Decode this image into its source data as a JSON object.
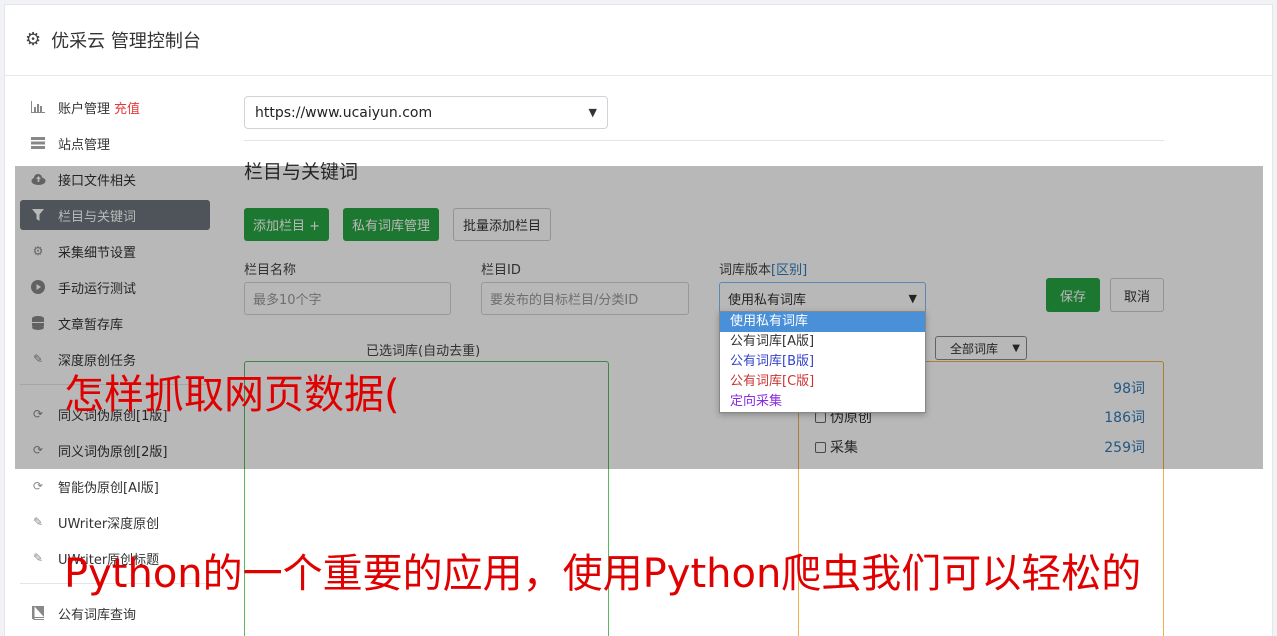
{
  "header": {
    "title": "优采云 管理控制台",
    "icon": "gear-icon"
  },
  "sidebar": {
    "items": [
      {
        "label": "账户管理",
        "extra": "充值",
        "icon": "bar-chart-icon"
      },
      {
        "label": "站点管理",
        "icon": "server-icon"
      },
      {
        "label": "接口文件相关",
        "icon": "cloud-upload-icon"
      },
      {
        "label": "栏目与关键词",
        "icon": "filter-icon",
        "active": true
      },
      {
        "label": "采集细节设置",
        "icon": "cogs-icon"
      },
      {
        "label": "手动运行测试",
        "icon": "play-circle-icon"
      },
      {
        "label": "文章暂存库",
        "icon": "database-icon"
      },
      {
        "label": "深度原创任务",
        "icon": "edit-icon"
      },
      {
        "label": "同义词伪原创[1版]",
        "icon": "refresh-icon"
      },
      {
        "label": "同义词伪原创[2版]",
        "icon": "refresh-icon"
      },
      {
        "label": "智能伪原创[AI版]",
        "icon": "refresh-icon"
      },
      {
        "label": "UWriter深度原创",
        "icon": "edit-icon"
      },
      {
        "label": "UWriter原创标题",
        "icon": "edit-icon"
      },
      {
        "label": "公有词库查询",
        "icon": "book-icon"
      }
    ]
  },
  "main": {
    "site_select": "https://www.ucaiyun.com",
    "section_title": "栏目与关键词",
    "buttons": {
      "add_column": "添加栏目 +",
      "private_lib": "私有词库管理",
      "batch_add": "批量添加栏目"
    },
    "fields": {
      "column_name_label": "栏目名称",
      "column_name_placeholder": "最多10个字",
      "column_id_label": "栏目ID",
      "column_id_placeholder": "要发布的目标栏目/分类ID",
      "lib_version_label": "词库版本",
      "lib_version_link": "[区别]",
      "lib_version_value": "使用私有词库"
    },
    "save": "保存",
    "cancel": "取消",
    "dropdown_options": [
      {
        "label": "使用私有词库",
        "color": "#ffffff"
      },
      {
        "label": "公有词库[A版]",
        "color": "#333333"
      },
      {
        "label": "公有词库[B版]",
        "color": "#3344cc"
      },
      {
        "label": "公有词库[C版]",
        "color": "#cc3333"
      },
      {
        "label": "定向采集",
        "color": "#8a2be2"
      }
    ],
    "selected_lib_label": "已选词库(自动去重)",
    "lib_filter": "全部词库",
    "libs": [
      {
        "name": "",
        "count": "98词"
      },
      {
        "name": "伪原创",
        "count": "186词"
      },
      {
        "name": "采集",
        "count": "259词"
      }
    ]
  },
  "overlay_text": {
    "line1": "怎样抓取网页数据(",
    "line2": "Python的一个重要的应用，使用Python爬虫我们可以轻松的"
  }
}
